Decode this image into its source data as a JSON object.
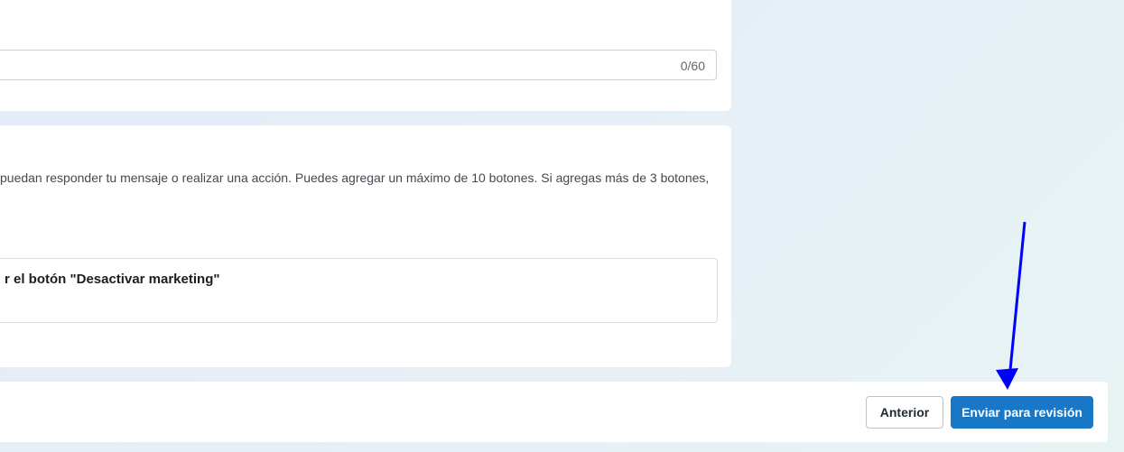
{
  "footer_field": {
    "char_counter": "0/60"
  },
  "buttons_section": {
    "description": "puedan responder tu mensaje o realizar una acción. Puedes agregar un máximo de 10 botones. Si agregas más de 3 botones,",
    "button_item_label": "r el botón \"Desactivar marketing\""
  },
  "footer_bar": {
    "previous_label": "Anterior",
    "submit_label": "Enviar para revisión"
  },
  "annotation": {
    "arrow_color": "#0000ff"
  },
  "colors": {
    "primary": "#1877c7",
    "background": "#e6eff7"
  }
}
